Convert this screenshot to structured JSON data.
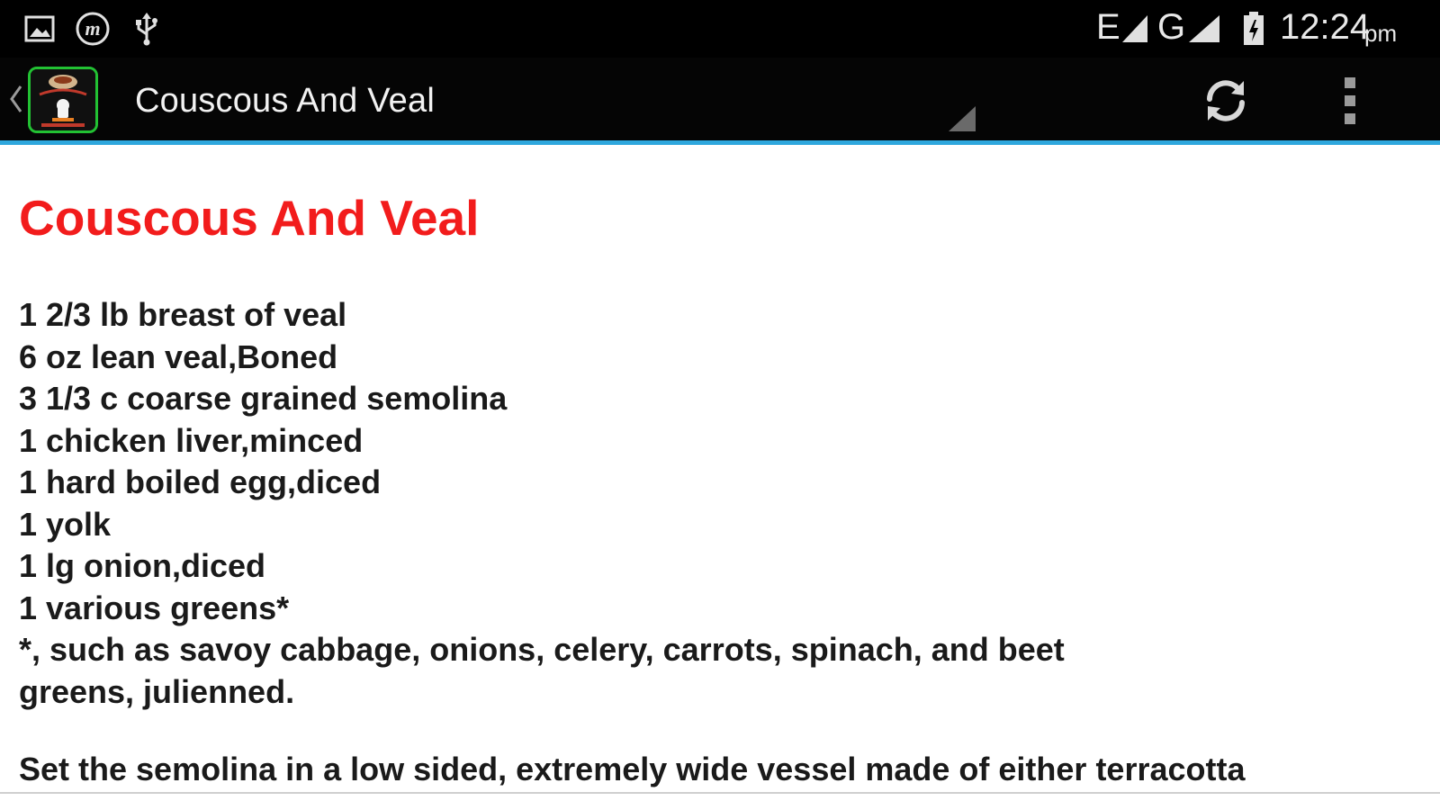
{
  "status_bar": {
    "icons_left": [
      "gallery-icon",
      "m-app-icon",
      "usb-icon"
    ],
    "network_edge_label": "E",
    "network_g_label": "G",
    "time": "12:24",
    "ampm": "pm"
  },
  "action_bar": {
    "title": "Couscous And Veal",
    "refresh_icon": "refresh-icon",
    "overflow_icon": "overflow-menu-icon"
  },
  "recipe": {
    "title": "Couscous And Veal",
    "ingredients": [
      "1 2/3 lb breast of veal",
      "6 oz lean veal,Boned",
      "3 1/3 c coarse grained semolina",
      "1 chicken liver,minced",
      "1 hard boiled egg,diced",
      "1 yolk",
      "1 lg onion,diced",
      "1 various greens*"
    ],
    "note_line1": "*, such as savoy cabbage, onions, celery, carrots, spinach, and beet",
    "note_line2": "greens, julienned.",
    "directions": "Set the semolina in a low sided, extremely wide vessel made of either terracotta"
  },
  "colors": {
    "title_red": "#f21c1c",
    "accent_blue": "#2ea7dd",
    "icon_border_green": "#22c233"
  }
}
